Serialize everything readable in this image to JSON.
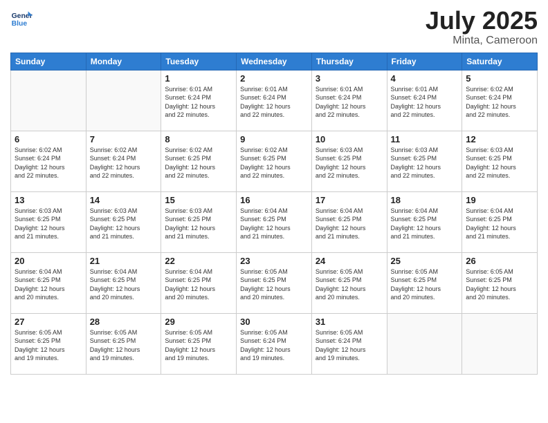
{
  "logo": {
    "line1": "General",
    "line2": "Blue"
  },
  "title": "July 2025",
  "location": "Minta, Cameroon",
  "weekdays": [
    "Sunday",
    "Monday",
    "Tuesday",
    "Wednesday",
    "Thursday",
    "Friday",
    "Saturday"
  ],
  "weeks": [
    [
      {
        "day": "",
        "info": ""
      },
      {
        "day": "",
        "info": ""
      },
      {
        "day": "1",
        "info": "Sunrise: 6:01 AM\nSunset: 6:24 PM\nDaylight: 12 hours\nand 22 minutes."
      },
      {
        "day": "2",
        "info": "Sunrise: 6:01 AM\nSunset: 6:24 PM\nDaylight: 12 hours\nand 22 minutes."
      },
      {
        "day": "3",
        "info": "Sunrise: 6:01 AM\nSunset: 6:24 PM\nDaylight: 12 hours\nand 22 minutes."
      },
      {
        "day": "4",
        "info": "Sunrise: 6:01 AM\nSunset: 6:24 PM\nDaylight: 12 hours\nand 22 minutes."
      },
      {
        "day": "5",
        "info": "Sunrise: 6:02 AM\nSunset: 6:24 PM\nDaylight: 12 hours\nand 22 minutes."
      }
    ],
    [
      {
        "day": "6",
        "info": "Sunrise: 6:02 AM\nSunset: 6:24 PM\nDaylight: 12 hours\nand 22 minutes."
      },
      {
        "day": "7",
        "info": "Sunrise: 6:02 AM\nSunset: 6:24 PM\nDaylight: 12 hours\nand 22 minutes."
      },
      {
        "day": "8",
        "info": "Sunrise: 6:02 AM\nSunset: 6:25 PM\nDaylight: 12 hours\nand 22 minutes."
      },
      {
        "day": "9",
        "info": "Sunrise: 6:02 AM\nSunset: 6:25 PM\nDaylight: 12 hours\nand 22 minutes."
      },
      {
        "day": "10",
        "info": "Sunrise: 6:03 AM\nSunset: 6:25 PM\nDaylight: 12 hours\nand 22 minutes."
      },
      {
        "day": "11",
        "info": "Sunrise: 6:03 AM\nSunset: 6:25 PM\nDaylight: 12 hours\nand 22 minutes."
      },
      {
        "day": "12",
        "info": "Sunrise: 6:03 AM\nSunset: 6:25 PM\nDaylight: 12 hours\nand 22 minutes."
      }
    ],
    [
      {
        "day": "13",
        "info": "Sunrise: 6:03 AM\nSunset: 6:25 PM\nDaylight: 12 hours\nand 21 minutes."
      },
      {
        "day": "14",
        "info": "Sunrise: 6:03 AM\nSunset: 6:25 PM\nDaylight: 12 hours\nand 21 minutes."
      },
      {
        "day": "15",
        "info": "Sunrise: 6:03 AM\nSunset: 6:25 PM\nDaylight: 12 hours\nand 21 minutes."
      },
      {
        "day": "16",
        "info": "Sunrise: 6:04 AM\nSunset: 6:25 PM\nDaylight: 12 hours\nand 21 minutes."
      },
      {
        "day": "17",
        "info": "Sunrise: 6:04 AM\nSunset: 6:25 PM\nDaylight: 12 hours\nand 21 minutes."
      },
      {
        "day": "18",
        "info": "Sunrise: 6:04 AM\nSunset: 6:25 PM\nDaylight: 12 hours\nand 21 minutes."
      },
      {
        "day": "19",
        "info": "Sunrise: 6:04 AM\nSunset: 6:25 PM\nDaylight: 12 hours\nand 21 minutes."
      }
    ],
    [
      {
        "day": "20",
        "info": "Sunrise: 6:04 AM\nSunset: 6:25 PM\nDaylight: 12 hours\nand 20 minutes."
      },
      {
        "day": "21",
        "info": "Sunrise: 6:04 AM\nSunset: 6:25 PM\nDaylight: 12 hours\nand 20 minutes."
      },
      {
        "day": "22",
        "info": "Sunrise: 6:04 AM\nSunset: 6:25 PM\nDaylight: 12 hours\nand 20 minutes."
      },
      {
        "day": "23",
        "info": "Sunrise: 6:05 AM\nSunset: 6:25 PM\nDaylight: 12 hours\nand 20 minutes."
      },
      {
        "day": "24",
        "info": "Sunrise: 6:05 AM\nSunset: 6:25 PM\nDaylight: 12 hours\nand 20 minutes."
      },
      {
        "day": "25",
        "info": "Sunrise: 6:05 AM\nSunset: 6:25 PM\nDaylight: 12 hours\nand 20 minutes."
      },
      {
        "day": "26",
        "info": "Sunrise: 6:05 AM\nSunset: 6:25 PM\nDaylight: 12 hours\nand 20 minutes."
      }
    ],
    [
      {
        "day": "27",
        "info": "Sunrise: 6:05 AM\nSunset: 6:25 PM\nDaylight: 12 hours\nand 19 minutes."
      },
      {
        "day": "28",
        "info": "Sunrise: 6:05 AM\nSunset: 6:25 PM\nDaylight: 12 hours\nand 19 minutes."
      },
      {
        "day": "29",
        "info": "Sunrise: 6:05 AM\nSunset: 6:25 PM\nDaylight: 12 hours\nand 19 minutes."
      },
      {
        "day": "30",
        "info": "Sunrise: 6:05 AM\nSunset: 6:24 PM\nDaylight: 12 hours\nand 19 minutes."
      },
      {
        "day": "31",
        "info": "Sunrise: 6:05 AM\nSunset: 6:24 PM\nDaylight: 12 hours\nand 19 minutes."
      },
      {
        "day": "",
        "info": ""
      },
      {
        "day": "",
        "info": ""
      }
    ]
  ]
}
